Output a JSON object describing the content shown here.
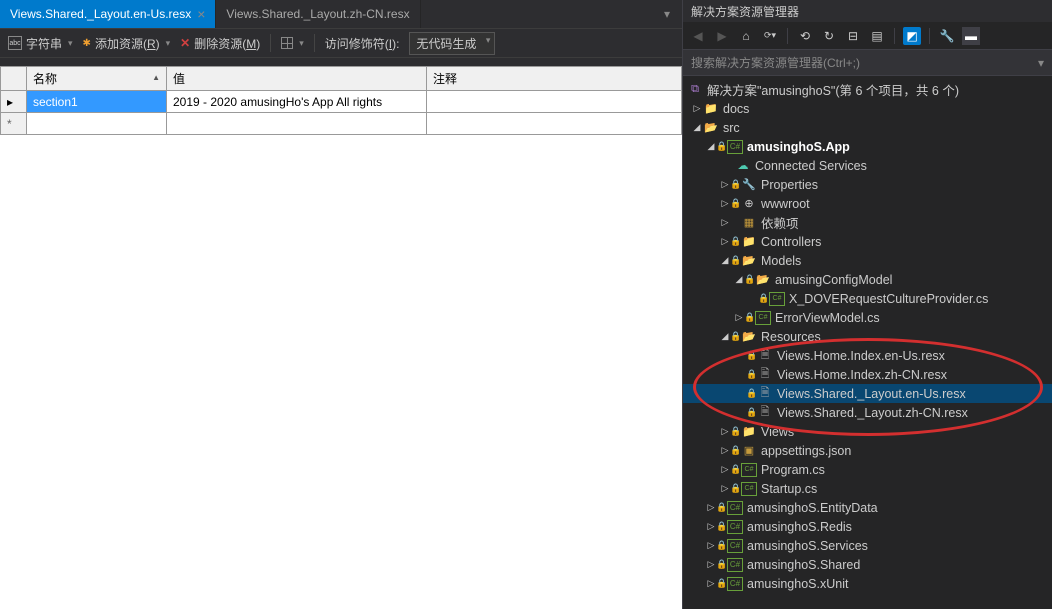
{
  "tabs": [
    {
      "label": "Views.Shared._Layout.en-Us.resx",
      "active": true
    },
    {
      "label": "Views.Shared._Layout.zh-CN.resx",
      "active": false
    }
  ],
  "toolbar": {
    "strings_label": "字符串",
    "add_resource": "添加资源(R)",
    "remove_resource": "删除资源(M)",
    "access_modifier_label": "访问修饰符(I):",
    "access_modifier_value": "无代码生成"
  },
  "grid": {
    "headers": {
      "name": "名称",
      "value": "值",
      "comment": "注释"
    },
    "rows": [
      {
        "name": "section1",
        "value": "2019 - 2020 amusingHo's App All rights",
        "comment": ""
      }
    ]
  },
  "solution_explorer": {
    "title": "解决方案资源管理器",
    "search_placeholder": "搜索解决方案资源管理器(Ctrl+;)",
    "solution_label": "解决方案\"amusinghoS\"(第 6 个项目，共 6 个)",
    "tree": {
      "docs": "docs",
      "src": "src",
      "app": "amusinghoS.App",
      "connected": "Connected Services",
      "properties": "Properties",
      "wwwroot": "wwwroot",
      "deps": "依赖项",
      "controllers": "Controllers",
      "models": "Models",
      "configmodel": "amusingConfigModel",
      "culture": "X_DOVERequestCultureProvider.cs",
      "errorvm": "ErrorViewModel.cs",
      "resources": "Resources",
      "r1": "Views.Home.Index.en-Us.resx",
      "r2": "Views.Home.Index.zh-CN.resx",
      "r3": "Views.Shared._Layout.en-Us.resx",
      "r4": "Views.Shared._Layout.zh-CN.resx",
      "views": "Views",
      "appsettings": "appsettings.json",
      "program": "Program.cs",
      "startup": "Startup.cs",
      "entitydata": "amusinghoS.EntityData",
      "redis": "amusinghoS.Redis",
      "services": "amusinghoS.Services",
      "shared": "amusinghoS.Shared",
      "xunit": "amusinghoS.xUnit"
    }
  }
}
